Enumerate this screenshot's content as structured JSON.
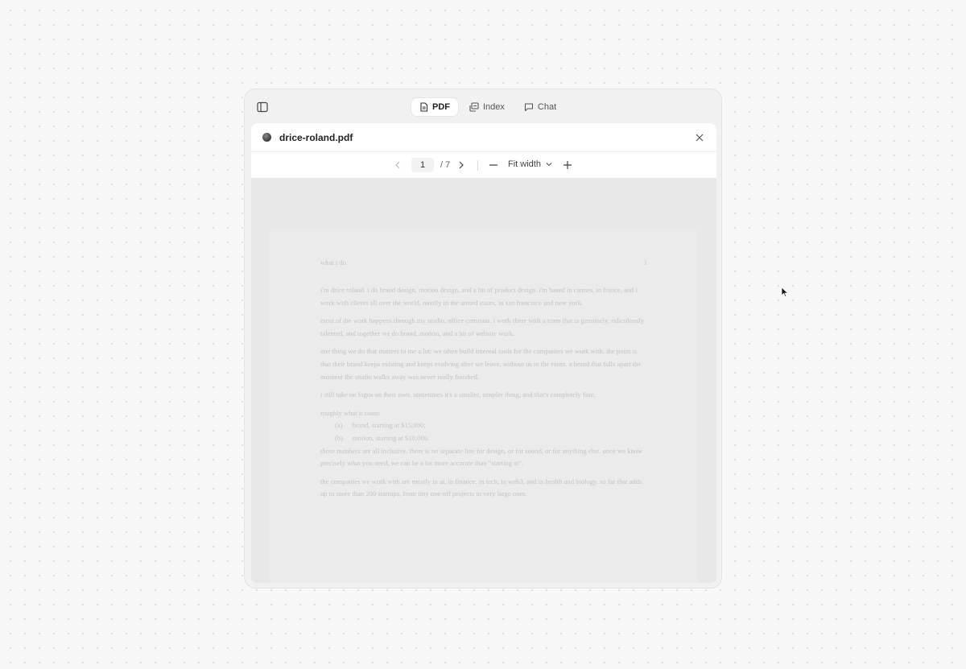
{
  "tabs": [
    {
      "label": "PDF",
      "icon": "document-icon",
      "active": true
    },
    {
      "label": "Index",
      "icon": "layers-icon",
      "active": false
    },
    {
      "label": "Chat",
      "icon": "chat-bubble-icon",
      "active": false
    }
  ],
  "document": {
    "file_name": "drice-roland.pdf"
  },
  "toolbar": {
    "current_page": "1",
    "page_total": "/ 7",
    "zoom_label": "Fit width"
  },
  "page_content": {
    "heading": "what i do",
    "page_number": "1",
    "paragraphs": [
      "i'm drice roland. i do brand design, motion design, and a bit of product design. i'm based in cannes, in france, and i work with clients all over the world, mostly in the united states, in san francisco and new york.",
      "most of the work happens through my studio, office commun. i work there with a team that is genuinely, ridiculously talented, and together we do brand, motion, and a bit of website work.",
      "one thing we do that matters to me a lot: we often build internal tools for the companies we work with. the point is that their brand keeps existing and keeps evolving after we leave, without us in the room. a brand that falls apart the moment the studio walks away was never really finished.",
      "i still take on logos on their own. sometimes it's a smaller, simpler thing, and that's completely fine."
    ],
    "pricing_intro": "roughly what it costs:",
    "pricing_items": [
      {
        "label": "(a)",
        "text": "brand, starting at $15,000;"
      },
      {
        "label": "(b)",
        "text": "motion, starting at $10,000."
      }
    ],
    "paragraphs_after": [
      "those numbers are all inclusive. there is no separate line for design, or for sound, or for anything else. once we know precisely what you need, we can be a lot more accurate than \"starting at\".",
      "the companies we work with are mostly in ai, in finance, in tech, in web3, and in health and biology. so far that adds up to more than 200 startups, from tiny one-off projects to very large ones."
    ]
  },
  "colors": {
    "background": "#f7f7f7",
    "window": "#f1f1f1",
    "panel": "#ffffff",
    "page": "#ebebeb",
    "faded_text": "#c4c4c4"
  }
}
